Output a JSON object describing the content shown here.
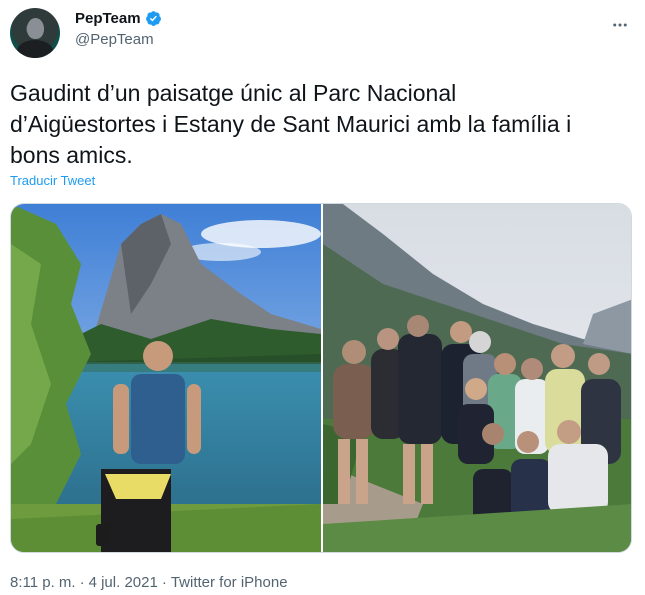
{
  "author": {
    "display_name": "PepTeam",
    "handle": "@PepTeam",
    "verified": true,
    "avatar_icon": "profile-avatar"
  },
  "tweet": {
    "text_lines": [
      "Gaudint d’un paisatge únic al Parc Nacional",
      "d’Aigüestortes i Estany de Sant Maurici amb la família i",
      "bons amics."
    ],
    "translate_label": "Traducir Tweet"
  },
  "media": {
    "count": 2,
    "photos": [
      {
        "description_icon": "mountain-lake-photo"
      },
      {
        "description_icon": "group-photo"
      }
    ]
  },
  "footer": {
    "time": "8:11 p. m.",
    "separator1": "·",
    "date": "4 jul. 2021",
    "separator2": "·",
    "source": "Twitter for iPhone"
  },
  "colors": {
    "link": "#1d9bf0",
    "muted": "#536471",
    "verified": "#1d9bf0"
  },
  "icons": {
    "more": "more-options-icon",
    "verified": "verified-badge-icon"
  }
}
